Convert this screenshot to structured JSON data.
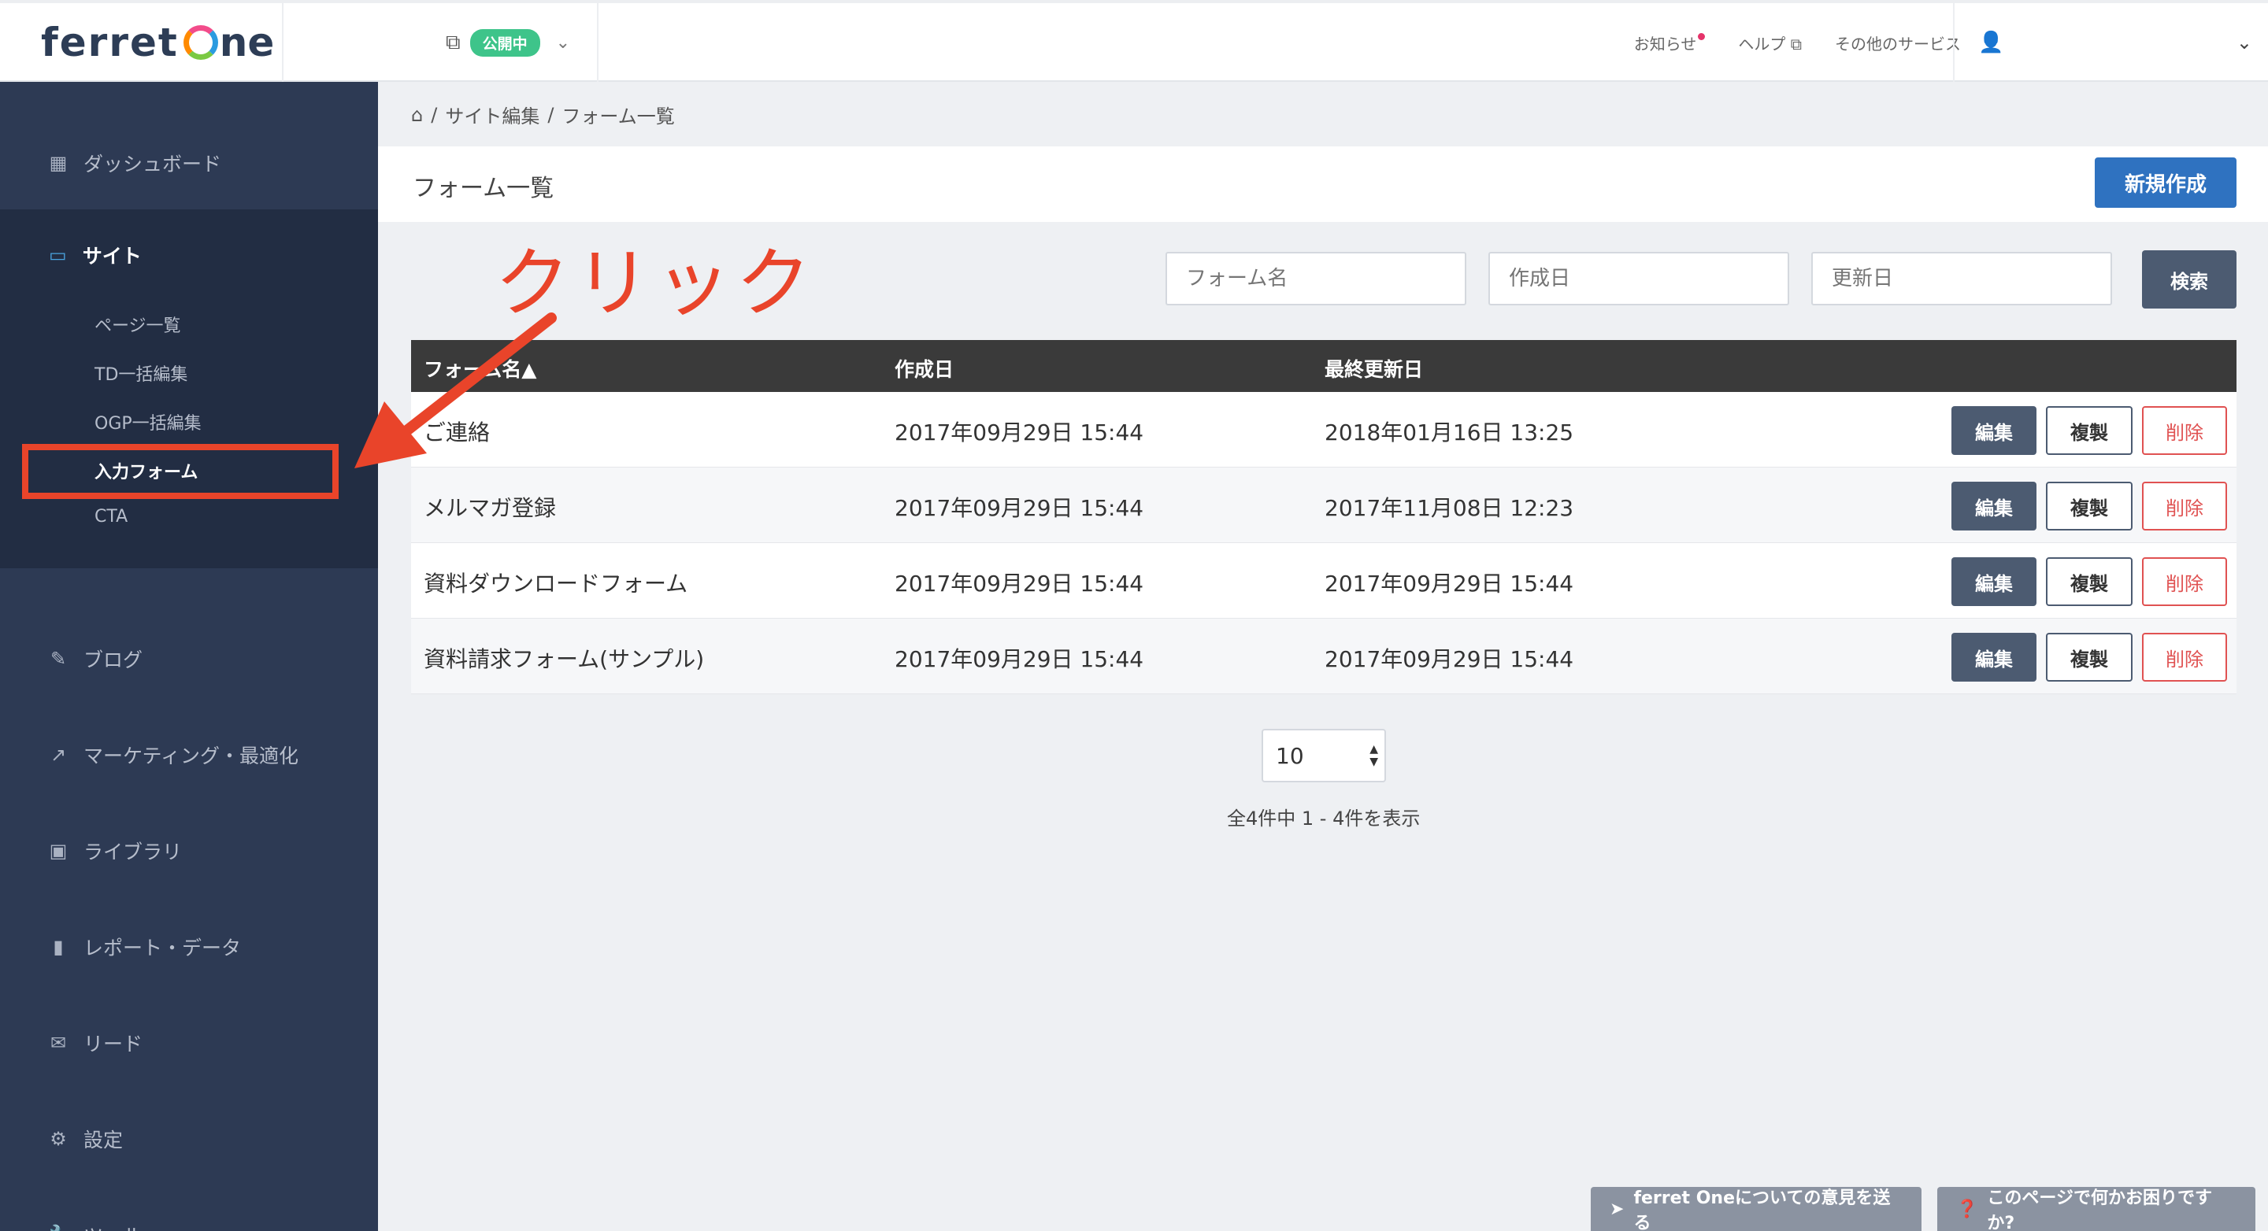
{
  "header": {
    "logo_text_1": "ferret",
    "logo_text_2": "ne",
    "publish_badge": "公開中",
    "nav": [
      "お知らせ",
      "ヘルプ",
      "その他のサービス"
    ]
  },
  "sidebar": {
    "items": [
      {
        "label": "ダッシュボード",
        "icon": "dashboard-icon"
      },
      {
        "label": "ブログ",
        "icon": "pencil-icon"
      },
      {
        "label": "マーケティング・最適化",
        "icon": "trend-icon"
      },
      {
        "label": "ライブラリ",
        "icon": "image-icon"
      },
      {
        "label": "レポート・データ",
        "icon": "bar-chart-icon"
      },
      {
        "label": "リード",
        "icon": "mail-icon"
      },
      {
        "label": "設定",
        "icon": "gear-icon"
      },
      {
        "label": "ツール",
        "icon": "wrench-icon"
      }
    ],
    "site": {
      "label": "サイト",
      "sub_items": [
        "ページ一覧",
        "TD一括編集",
        "OGP一括編集",
        "入力フォーム",
        "CTA"
      ]
    }
  },
  "breadcrumb": {
    "items": [
      "サイト編集",
      "フォーム一覧"
    ]
  },
  "page": {
    "title": "フォーム一覧",
    "new_button": "新規作成"
  },
  "search": {
    "name_placeholder": "フォーム名",
    "created_placeholder": "作成日",
    "updated_placeholder": "更新日",
    "button": "検索"
  },
  "annotation": {
    "text": "クリック"
  },
  "table": {
    "headers": {
      "name": "フォーム名▲",
      "created": "作成日",
      "updated": "最終更新日"
    },
    "rows": [
      {
        "name": "ご連絡",
        "created": "2017年09月29日 15:44",
        "updated": "2018年01月16日 13:25"
      },
      {
        "name": "メルマガ登録",
        "created": "2017年09月29日 15:44",
        "updated": "2017年11月08日 12:23"
      },
      {
        "name": "資料ダウンロードフォーム",
        "created": "2017年09月29日 15:44",
        "updated": "2017年09月29日 15:44"
      },
      {
        "name": "資料請求フォーム(サンプル)",
        "created": "2017年09月29日 15:44",
        "updated": "2017年09月29日 15:44"
      }
    ],
    "actions": {
      "edit": "編集",
      "copy": "複製",
      "delete": "削除"
    }
  },
  "pagination": {
    "per_page": "10",
    "summary": "全4件中 1 - 4件を表示"
  },
  "footer": {
    "feedback": "ferret Oneについての意見を送る",
    "help": "このページで何かお困りですか?"
  },
  "colors": {
    "accent": "#2f72c0",
    "sidebar": "#2d3a54",
    "annotation": "#e9442a",
    "public": "#3ec48a"
  }
}
